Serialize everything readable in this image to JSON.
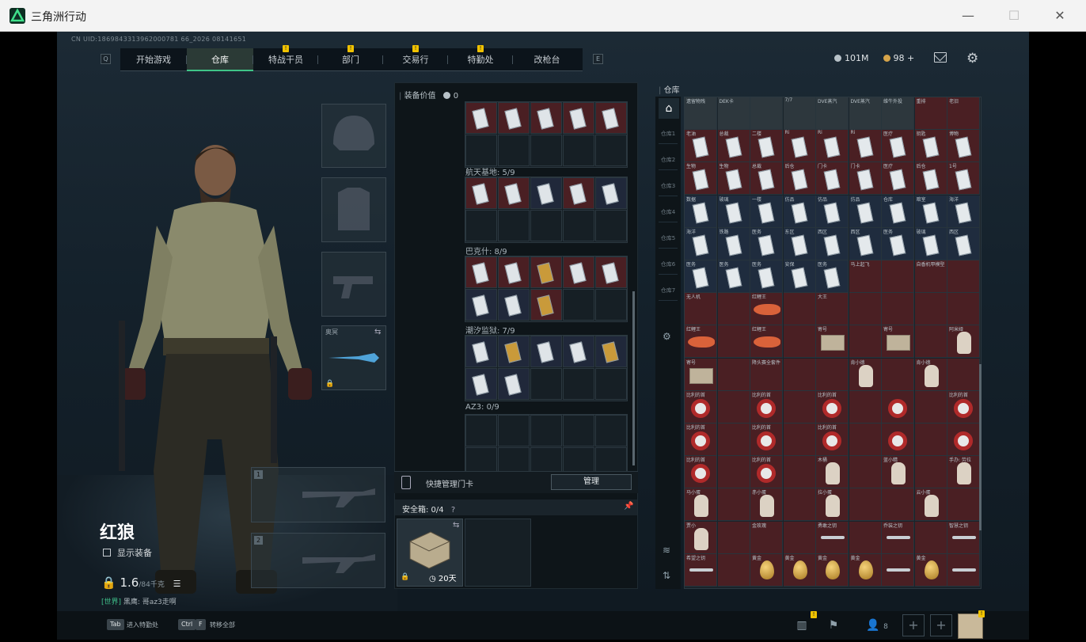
{
  "window": {
    "title": "三角洲行动",
    "minimize": "—",
    "maximize": "☐",
    "close": "✕"
  },
  "uid": "CN UID:1869843313962000781 66_2026 08141651",
  "nav": {
    "left_key": "Q",
    "right_key": "E",
    "tabs": [
      {
        "label": "开始游戏",
        "badge": ""
      },
      {
        "label": "仓库",
        "badge": "",
        "active": true
      },
      {
        "label": "特战干员",
        "badge": "!"
      },
      {
        "label": "部门",
        "badge": "!"
      },
      {
        "label": "交易行",
        "badge": "!"
      },
      {
        "label": "特勤处",
        "badge": "!"
      },
      {
        "label": "改枪台",
        "badge": ""
      }
    ]
  },
  "currency": {
    "silver": "101M",
    "gold": "98",
    "gold_add": "+"
  },
  "character": {
    "name": "红狼",
    "show_equipment": "显示装备",
    "weight": "1.6",
    "weight_max": "/84千克",
    "chat_channel": "[世界]",
    "chat_text": "黑鹰: 哥az3走啊",
    "slot_labels": {
      "gun": "奥冥",
      "primary1": "1",
      "primary2": "2"
    }
  },
  "equipment_value": {
    "label": "装备价值",
    "value": "0"
  },
  "containers": [
    {
      "title": "",
      "count": ""
    },
    {
      "title": "航天基地: 5/9"
    },
    {
      "title": "巴克什: 8/9"
    },
    {
      "title": "潮汐监狱: 7/9"
    },
    {
      "title": "AZ3: 0/9"
    }
  ],
  "quick_manage": {
    "label": "快捷管理门卡",
    "button": "管理"
  },
  "safe_box": {
    "title": "安全箱: 0/4",
    "help": "?",
    "days": "20天"
  },
  "warehouse": {
    "title": "仓库",
    "home_icon": "⌂",
    "side_tabs": [
      "仓库1",
      "仓库2",
      "仓库3",
      "仓库4",
      "仓库5",
      "仓库6",
      "仓库7"
    ],
    "rows": [
      [
        {
          "t": "遗留物残",
          "k": "gray"
        },
        {
          "t": "DEK卡",
          "k": "gray"
        },
        {
          "t": "",
          "k": "gray"
        },
        {
          "t": "7/7",
          "k": "gray"
        },
        {
          "t": "DVE蒸汽",
          "k": "gray"
        },
        {
          "t": "DVE蒸汽",
          "k": "gray"
        },
        {
          "t": "维牛外投",
          "k": "gray"
        },
        {
          "t": "重排",
          "k": "red"
        },
        {
          "t": "老旧",
          "k": "red"
        }
      ],
      [
        {
          "t": "老油",
          "k": "red",
          "d": 1
        },
        {
          "t": "总裁",
          "k": "red",
          "d": 1
        },
        {
          "t": "二楼",
          "k": "red",
          "d": 1
        },
        {
          "t": "Ri",
          "k": "red",
          "d": 1
        },
        {
          "t": "Ri",
          "k": "red",
          "d": 1
        },
        {
          "t": "Ri",
          "k": "red",
          "d": 1
        },
        {
          "t": "医疗",
          "k": "red",
          "d": 1
        },
        {
          "t": "钥匙",
          "k": "red",
          "d": 1
        },
        {
          "t": "博物",
          "k": "red",
          "d": 1
        }
      ],
      [
        {
          "t": "生物",
          "k": "red",
          "d": 1
        },
        {
          "t": "生物",
          "k": "red",
          "d": 1
        },
        {
          "t": "总裁",
          "k": "red",
          "d": 1
        },
        {
          "t": "后仓",
          "k": "red",
          "d": 1
        },
        {
          "t": "门卡",
          "k": "red",
          "d": 1
        },
        {
          "t": "门卡",
          "k": "red",
          "d": 1
        },
        {
          "t": "医疗",
          "k": "red",
          "d": 1
        },
        {
          "t": "后仓",
          "k": "red",
          "d": 1
        },
        {
          "t": "1号",
          "k": "red",
          "d": 1
        }
      ],
      [
        {
          "t": "数据",
          "k": "blue",
          "d": 1
        },
        {
          "t": "玻璃",
          "k": "blue",
          "d": 1
        },
        {
          "t": "一楼",
          "k": "blue",
          "d": 1
        },
        {
          "t": "仿品",
          "k": "blue",
          "d": 1
        },
        {
          "t": "仿品",
          "k": "blue",
          "d": 1
        },
        {
          "t": "仿品",
          "k": "blue",
          "d": 1
        },
        {
          "t": "仓库",
          "k": "blue",
          "d": 1
        },
        {
          "t": "暗室",
          "k": "blue",
          "d": 1
        },
        {
          "t": "海洋",
          "k": "blue",
          "d": 1
        }
      ],
      [
        {
          "t": "海洋",
          "k": "blue",
          "d": 1
        },
        {
          "t": "铁路",
          "k": "blue",
          "d": 1
        },
        {
          "t": "医务",
          "k": "blue",
          "d": 1
        },
        {
          "t": "东区",
          "k": "blue",
          "d": 1
        },
        {
          "t": "西区",
          "k": "blue",
          "d": 1
        },
        {
          "t": "西区",
          "k": "blue",
          "d": 1
        },
        {
          "t": "医务",
          "k": "blue",
          "d": 1
        },
        {
          "t": "玻璃",
          "k": "blue",
          "d": 1
        },
        {
          "t": "西区",
          "k": "blue",
          "d": 1
        }
      ],
      [
        {
          "t": "医务",
          "k": "blue",
          "d": 1
        },
        {
          "t": "医务",
          "k": "blue",
          "d": 1
        },
        {
          "t": "医务",
          "k": "blue",
          "d": 1
        },
        {
          "t": "安保",
          "k": "blue",
          "d": 1
        },
        {
          "t": "医务",
          "k": "blue",
          "d": 1
        },
        {
          "t": "马上起飞",
          "k": "red"
        },
        {
          "t": "",
          "k": "red"
        },
        {
          "t": "自香机甲模型",
          "k": "red"
        },
        {
          "t": "",
          "k": "red"
        }
      ],
      [
        {
          "t": "无人机",
          "k": "red"
        },
        {
          "t": "",
          "k": "red"
        },
        {
          "t": "红鲤王",
          "k": "red",
          "f": 1
        },
        {
          "t": "",
          "k": "red"
        },
        {
          "t": "大王",
          "k": "red"
        },
        {
          "t": "",
          "k": "red"
        },
        {
          "t": "",
          "k": "red"
        },
        {
          "t": "",
          "k": "red"
        },
        {
          "t": "",
          "k": "red"
        }
      ],
      [
        {
          "t": "红鲤王",
          "k": "red",
          "f": 1
        },
        {
          "t": "",
          "k": "red"
        },
        {
          "t": "红鲤王",
          "k": "red",
          "f": 1
        },
        {
          "t": "",
          "k": "red"
        },
        {
          "t": "寄号",
          "k": "red",
          "tan": 1
        },
        {
          "t": "",
          "k": "red"
        },
        {
          "t": "寄号",
          "k": "red",
          "tan": 1
        },
        {
          "t": "",
          "k": "red"
        },
        {
          "t": "阿米娅",
          "k": "red",
          "dl": 1
        }
      ],
      [
        {
          "t": "寄号",
          "k": "red",
          "tan": 1
        },
        {
          "t": "",
          "k": "red"
        },
        {
          "t": "降头赛全套件",
          "k": "red"
        },
        {
          "t": "",
          "k": "red"
        },
        {
          "t": "",
          "k": "red"
        },
        {
          "t": "肯小德",
          "k": "red",
          "dl": 1
        },
        {
          "t": "",
          "k": "red"
        },
        {
          "t": "肯小德",
          "k": "red",
          "dl": 1
        },
        {
          "t": "",
          "k": "red"
        }
      ],
      [
        {
          "t": "比利的首",
          "k": "red",
          "s": 1
        },
        {
          "t": "",
          "k": "red"
        },
        {
          "t": "比利的首",
          "k": "red",
          "s": 1
        },
        {
          "t": "",
          "k": "red"
        },
        {
          "t": "比利的首",
          "k": "red",
          "s": 1
        },
        {
          "t": "",
          "k": "red"
        },
        {
          "t": "",
          "k": "red",
          "s": 1
        },
        {
          "t": "",
          "k": "red"
        },
        {
          "t": "比利的首",
          "k": "red",
          "s": 1
        }
      ],
      [
        {
          "t": "比利的首",
          "k": "red",
          "s": 1
        },
        {
          "t": "",
          "k": "red"
        },
        {
          "t": "比利的首",
          "k": "red",
          "s": 1
        },
        {
          "t": "",
          "k": "red"
        },
        {
          "t": "比利的首",
          "k": "red",
          "s": 1
        },
        {
          "t": "",
          "k": "red"
        },
        {
          "t": "",
          "k": "red",
          "s": 1
        },
        {
          "t": "",
          "k": "red"
        },
        {
          "t": "",
          "k": "red",
          "s": 1
        }
      ],
      [
        {
          "t": "比利的首",
          "k": "red",
          "s": 1
        },
        {
          "t": "",
          "k": "red"
        },
        {
          "t": "比利的首",
          "k": "red",
          "s": 1
        },
        {
          "t": "",
          "k": "red"
        },
        {
          "t": "木桶",
          "k": "red",
          "dl": 1
        },
        {
          "t": "",
          "k": "red"
        },
        {
          "t": "蓝小精",
          "k": "red",
          "dl": 1
        },
        {
          "t": "",
          "k": "red"
        },
        {
          "t": "手办: 劳拉",
          "k": "red",
          "dl": 1
        }
      ],
      [
        {
          "t": "马小蛋",
          "k": "red",
          "dl": 1
        },
        {
          "t": "",
          "k": "red"
        },
        {
          "t": "赤小蛋",
          "k": "red",
          "dl": 1
        },
        {
          "t": "",
          "k": "red"
        },
        {
          "t": "拉小蛋",
          "k": "red",
          "dl": 1
        },
        {
          "t": "",
          "k": "red"
        },
        {
          "t": "",
          "k": "red"
        },
        {
          "t": "云小蛋",
          "k": "red",
          "dl": 1
        },
        {
          "t": "",
          "k": "red"
        }
      ],
      [
        {
          "t": "贾小",
          "k": "red",
          "dl": 1
        },
        {
          "t": "",
          "k": "red"
        },
        {
          "t": "金玫瑰",
          "k": "red"
        },
        {
          "t": "",
          "k": "red"
        },
        {
          "t": "勇敢之钥",
          "k": "red",
          "ky": 1
        },
        {
          "t": "",
          "k": "red"
        },
        {
          "t": "乔装之钥",
          "k": "red",
          "ky": 1
        },
        {
          "t": "",
          "k": "red"
        },
        {
          "t": "智慧之钥",
          "k": "red",
          "ky": 1
        }
      ],
      [
        {
          "t": "希望之钥",
          "k": "red",
          "ky": 1
        },
        {
          "t": "",
          "k": "red"
        },
        {
          "t": "黄金",
          "k": "red",
          "e": 1
        },
        {
          "t": "黄金",
          "k": "red",
          "e": 1
        },
        {
          "t": "黄金",
          "k": "red",
          "e": 1
        },
        {
          "t": "黄金",
          "k": "red",
          "e": 1
        },
        {
          "t": "",
          "k": "red",
          "ky": 1
        },
        {
          "t": "黄金",
          "k": "red",
          "e": 1
        },
        {
          "t": "",
          "k": "red",
          "ky": 1
        }
      ]
    ]
  },
  "bottom": {
    "tab_key": "Tab",
    "tab_label": "进入特勤处",
    "ctrl_key": "Ctrl",
    "f_key": "F",
    "ctrl_label": "转移全部",
    "friends": "8",
    "add": "+"
  }
}
